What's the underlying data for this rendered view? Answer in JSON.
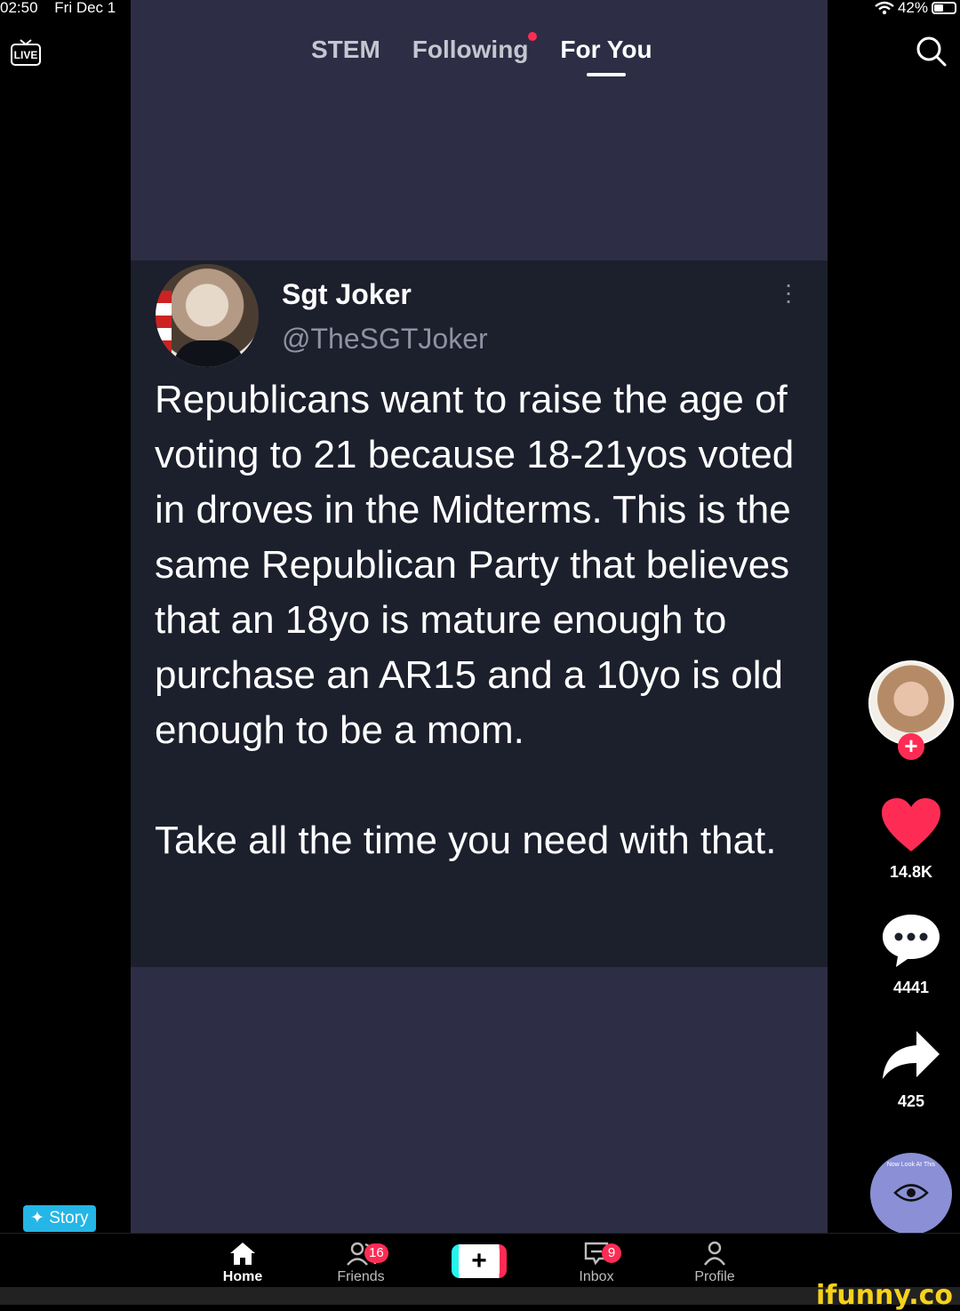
{
  "status": {
    "time": "02:50",
    "date": "Fri Dec 1",
    "battery": "42%",
    "battery_level": 0.42
  },
  "top_nav": {
    "live_label": "LIVE",
    "tabs": [
      {
        "label": "STEM",
        "active": false
      },
      {
        "label": "Following",
        "active": false,
        "has_dot": true
      },
      {
        "label": "For You",
        "active": true
      }
    ]
  },
  "post": {
    "name": "Sgt Joker",
    "handle": "@TheSGTJoker",
    "paragraphs": [
      "Republicans want to raise the age of voting to 21 because 18-21yos voted in droves in the Midterms. This is the same Republican Party that believes that an 18yo is mature enough to purchase an AR15 and a 10yo is old enough to be a mom.",
      "Take all the time you need with that."
    ]
  },
  "rail": {
    "likes": "14.8K",
    "comments": "4441",
    "shares": "425",
    "disc_text": "Now Look At This"
  },
  "story_label": "Story",
  "bottom_nav": {
    "home": "Home",
    "friends": "Friends",
    "friends_badge": "16",
    "inbox": "Inbox",
    "inbox_badge": "9",
    "profile": "Profile"
  },
  "watermark": "ifunny.co",
  "colors": {
    "accent": "#fe2c55",
    "cyan": "#25f4ee",
    "story": "#24b6e6",
    "video_bg": "#2d2e45",
    "post_bg": "#1c1f2c"
  }
}
